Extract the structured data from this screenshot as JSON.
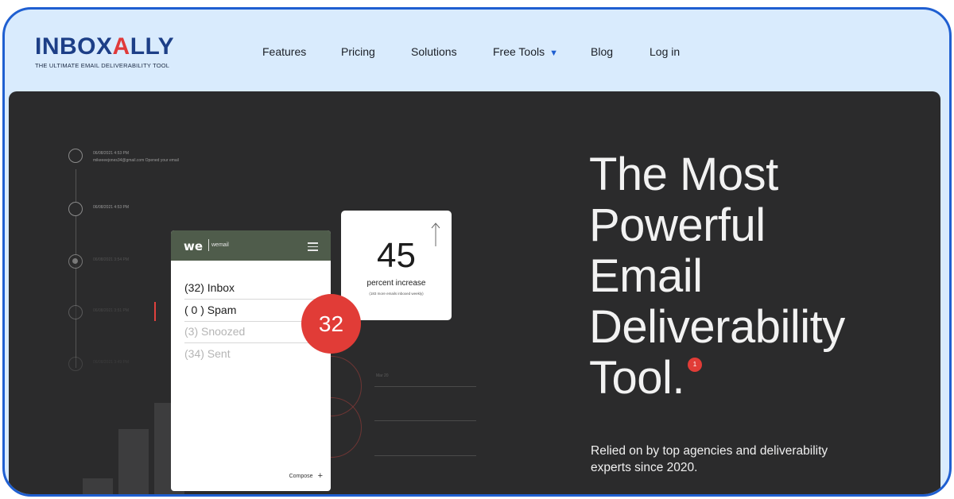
{
  "brand": {
    "name_part1": "INBOX",
    "name_mark": "A",
    "name_part2": "LLY",
    "tagline": "THE ULTIMATE EMAIL DELIVERABILITY TOOL"
  },
  "nav": {
    "items": [
      {
        "label": "Features"
      },
      {
        "label": "Pricing"
      },
      {
        "label": "Solutions"
      },
      {
        "label": "Free Tools",
        "caret": "▼"
      },
      {
        "label": "Blog"
      },
      {
        "label": "Log in"
      }
    ]
  },
  "timeline": {
    "entries": [
      {
        "date": "06/08/2021 4:53 PM",
        "detail": "mikeeeejones34@gmail.com Opened your email"
      },
      {
        "date": "06/08/2021 4:53 PM",
        "detail": ""
      },
      {
        "date": "06/08/2021 3:54 PM",
        "detail": ""
      },
      {
        "date": "06/08/2021 3:51 PM",
        "detail": ""
      },
      {
        "date": "06/08/2021 3:49 PM",
        "detail": ""
      }
    ],
    "faint_label": "Mar 20"
  },
  "phone": {
    "logo": "we",
    "sub": "wemail",
    "folders": [
      {
        "label": "(32) Inbox"
      },
      {
        "label": "( 0 ) Spam"
      },
      {
        "label": "(3) Snoozed"
      },
      {
        "label": "(34) Sent"
      }
    ],
    "compose": "Compose",
    "compose_plus": "+"
  },
  "badge": {
    "value": "32"
  },
  "stat_card": {
    "value": "45",
    "label": "percent increase",
    "sub": "(183 more emails inboxed weekly)"
  },
  "hero": {
    "headline_lines": [
      "The Most",
      "Powerful",
      "Email",
      "Deliverability",
      "Tool."
    ],
    "headline_badge": "1",
    "subline": "Relied on by top agencies and deliverability experts since 2020."
  },
  "colors": {
    "frame_border": "#1f5fd1",
    "header_bg": "#d9ebfd",
    "hero_bg": "#2b2b2c",
    "accent_red": "#e13c37",
    "phone_header": "#4f5c4b",
    "brand_navy": "#1d3f87"
  }
}
